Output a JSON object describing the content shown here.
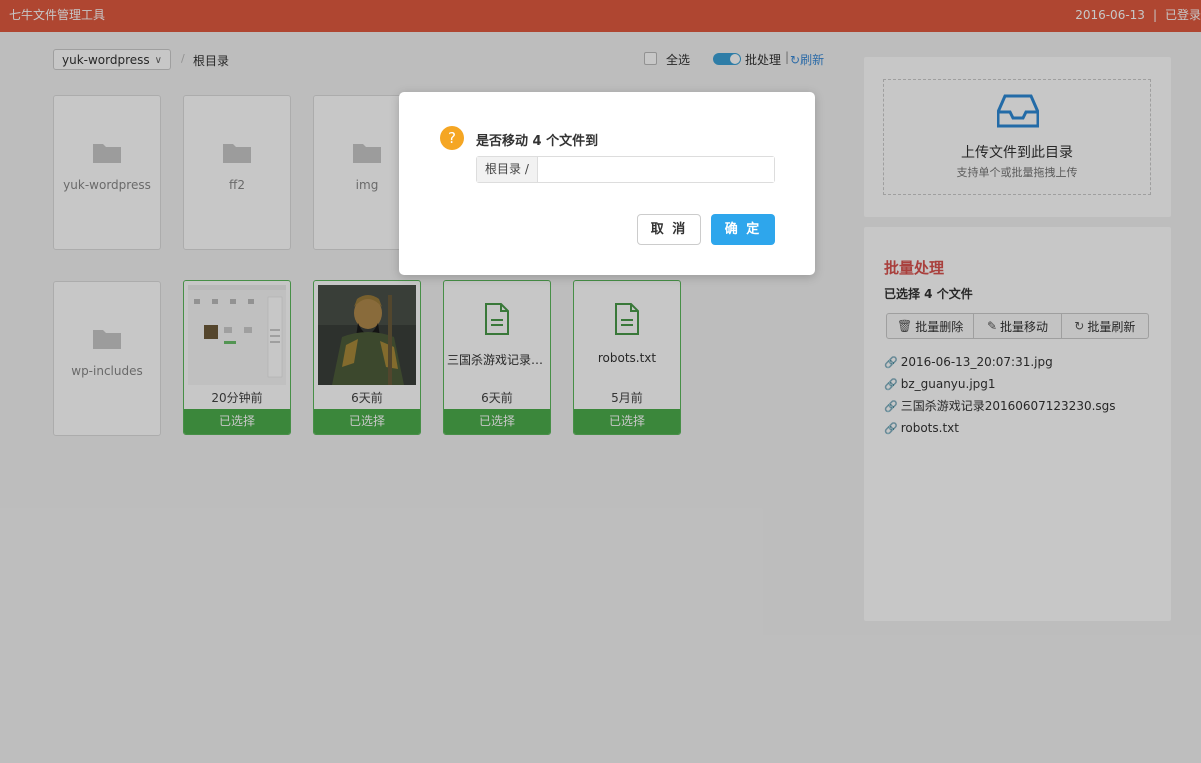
{
  "app": {
    "title": "七牛文件管理工具",
    "date": "2016-06-13",
    "separator": "|",
    "login_status": "已登录"
  },
  "toolbar": {
    "bucket": "yuk-wordpress",
    "breadcrumb_sep": "/",
    "breadcrumb": "根目录",
    "select_all": "全选",
    "batch_toggle": "批处理",
    "bar_sep": "|",
    "refresh": "刷新"
  },
  "folders": [
    {
      "name": "yuk-wordpress"
    },
    {
      "name": "ff2"
    },
    {
      "name": "img"
    },
    {
      "name": "wp-includes"
    }
  ],
  "files": [
    {
      "name": "",
      "time": "20分钟前",
      "status": "已选择",
      "kind": "screenshot"
    },
    {
      "name": "",
      "time": "6天前",
      "status": "已选择",
      "kind": "portrait"
    },
    {
      "name": "三国杀游戏记录20160607123230.sgs",
      "time": "6天前",
      "status": "已选择",
      "kind": "doc"
    },
    {
      "name": "robots.txt",
      "time": "5月前",
      "status": "已选择",
      "kind": "doc"
    }
  ],
  "upload": {
    "icon": "inbox-icon",
    "title": "上传文件到此目录",
    "subtitle": "支持单个或批量拖拽上传"
  },
  "batch": {
    "title": "批量处理",
    "count_text": "已选择 4 个文件",
    "buttons": [
      {
        "label": "批量删除",
        "icon": "trash-icon"
      },
      {
        "label": "批量移动",
        "icon": "edit-icon"
      },
      {
        "label": "批量刷新",
        "icon": "refresh-icon"
      }
    ],
    "files": [
      "2016-06-13_20:07:31.jpg",
      "bz_guanyu.jpg1",
      "三国杀游戏记录20160607123230.sgs",
      "robots.txt"
    ]
  },
  "modal": {
    "question": "是否移动 4 个文件到",
    "path_prefix": "根目录 /",
    "path_value": "",
    "cancel": "取 消",
    "ok": "确 定"
  },
  "colors": {
    "topbar": "#e05a3f",
    "accent_blue": "#2ea6ec",
    "selected_green": "#4cae4c",
    "batch_red": "#d9534f",
    "question_orange": "#f5a623"
  }
}
